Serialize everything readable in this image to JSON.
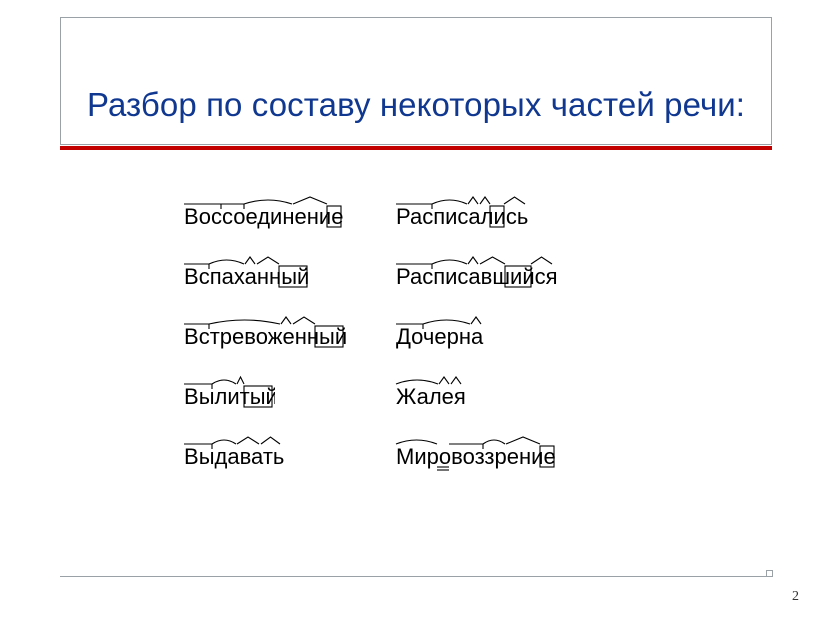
{
  "title": "Разбор по составу некоторых частей речи:",
  "page_number": "2",
  "columns": [
    {
      "words": [
        {
          "text": "Воссоединение",
          "chars": [
            {
              "c": "В",
              "w": 14,
              "mk": "prefix",
              "seg": "a"
            },
            {
              "c": "о",
              "w": 12,
              "mk": "prefix",
              "seg": "a"
            },
            {
              "c": "с",
              "w": 11,
              "mk": "prefix",
              "seg": "a"
            },
            {
              "c": "с",
              "w": 11,
              "mk": "prefix",
              "seg": "b"
            },
            {
              "c": "о",
              "w": 12,
              "mk": "prefix",
              "seg": "b"
            },
            {
              "c": "е",
              "w": 12,
              "mk": "root",
              "seg": "c"
            },
            {
              "c": "д",
              "w": 12,
              "mk": "root",
              "seg": "c"
            },
            {
              "c": "и",
              "w": 12,
              "mk": "root",
              "seg": "c"
            },
            {
              "c": "н",
              "w": 12,
              "mk": "root",
              "seg": "c"
            },
            {
              "c": "е",
              "w": 12,
              "mk": "suffix",
              "seg": "d"
            },
            {
              "c": "н",
              "w": 12,
              "mk": "suffix",
              "seg": "d"
            },
            {
              "c": "и",
              "w": 12,
              "mk": "suffix",
              "seg": "d"
            },
            {
              "c": "е",
              "w": 12,
              "mk": "ending",
              "seg": "e"
            }
          ]
        },
        {
          "text": "Вспаханный",
          "chars": [
            {
              "c": "В",
              "w": 14,
              "mk": "prefix",
              "seg": "a"
            },
            {
              "c": "с",
              "w": 11,
              "mk": "prefix",
              "seg": "a"
            },
            {
              "c": "п",
              "w": 12,
              "mk": "root",
              "seg": "b"
            },
            {
              "c": "а",
              "w": 12,
              "mk": "root",
              "seg": "b"
            },
            {
              "c": "х",
              "w": 11,
              "mk": "root",
              "seg": "b"
            },
            {
              "c": "а",
              "w": 12,
              "mk": "suffix",
              "seg": "c"
            },
            {
              "c": "н",
              "w": 12,
              "mk": "suffix",
              "seg": "d"
            },
            {
              "c": "н",
              "w": 12,
              "mk": "suffix",
              "seg": "d"
            },
            {
              "c": "ы",
              "w": 14,
              "mk": "ending",
              "seg": "e"
            },
            {
              "c": "й",
              "w": 12,
              "mk": "ending",
              "seg": "e"
            }
          ]
        },
        {
          "text": "Встревоженный",
          "chars": [
            {
              "c": "В",
              "w": 14,
              "mk": "prefix",
              "seg": "a"
            },
            {
              "c": "с",
              "w": 11,
              "mk": "prefix",
              "seg": "a"
            },
            {
              "c": "т",
              "w": 9,
              "mk": "root",
              "seg": "b"
            },
            {
              "c": "р",
              "w": 12,
              "mk": "root",
              "seg": "b"
            },
            {
              "c": "е",
              "w": 12,
              "mk": "root",
              "seg": "b"
            },
            {
              "c": "в",
              "w": 12,
              "mk": "root",
              "seg": "b"
            },
            {
              "c": "о",
              "w": 12,
              "mk": "root",
              "seg": "b"
            },
            {
              "c": "ж",
              "w": 14,
              "mk": "root",
              "seg": "b"
            },
            {
              "c": "е",
              "w": 12,
              "mk": "suffix",
              "seg": "c"
            },
            {
              "c": "н",
              "w": 12,
              "mk": "suffix",
              "seg": "d"
            },
            {
              "c": "н",
              "w": 12,
              "mk": "suffix",
              "seg": "d"
            },
            {
              "c": "ы",
              "w": 14,
              "mk": "ending",
              "seg": "e"
            },
            {
              "c": "й",
              "w": 12,
              "mk": "ending",
              "seg": "e"
            }
          ]
        },
        {
          "text": "Вылитый",
          "chars": [
            {
              "c": "В",
              "w": 14,
              "mk": "prefix",
              "seg": "a"
            },
            {
              "c": "ы",
              "w": 14,
              "mk": "prefix",
              "seg": "a"
            },
            {
              "c": "л",
              "w": 12,
              "mk": "root",
              "seg": "b"
            },
            {
              "c": "и",
              "w": 12,
              "mk": "root",
              "seg": "b"
            },
            {
              "c": "т",
              "w": 9,
              "mk": "suffix",
              "seg": "c"
            },
            {
              "c": "ы",
              "w": 14,
              "mk": "ending",
              "seg": "d"
            },
            {
              "c": "й",
              "w": 12,
              "mk": "ending",
              "seg": "d"
            }
          ]
        },
        {
          "text": "Выдавать",
          "chars": [
            {
              "c": "В",
              "w": 14,
              "mk": "prefix",
              "seg": "a"
            },
            {
              "c": "ы",
              "w": 14,
              "mk": "prefix",
              "seg": "a"
            },
            {
              "c": "д",
              "w": 12,
              "mk": "root",
              "seg": "b"
            },
            {
              "c": "а",
              "w": 12,
              "mk": "root",
              "seg": "b"
            },
            {
              "c": "в",
              "w": 12,
              "mk": "suffix",
              "seg": "c"
            },
            {
              "c": "а",
              "w": 12,
              "mk": "suffix",
              "seg": "c"
            },
            {
              "c": "т",
              "w": 9,
              "mk": "suffix",
              "seg": "d"
            },
            {
              "c": "ь",
              "w": 12,
              "mk": "suffix",
              "seg": "d"
            }
          ]
        }
      ]
    },
    {
      "words": [
        {
          "text": "Расписались",
          "chars": [
            {
              "c": "Р",
              "w": 13,
              "mk": "prefix",
              "seg": "a"
            },
            {
              "c": "а",
              "w": 12,
              "mk": "prefix",
              "seg": "a"
            },
            {
              "c": "с",
              "w": 11,
              "mk": "prefix",
              "seg": "a"
            },
            {
              "c": "п",
              "w": 12,
              "mk": "root",
              "seg": "b"
            },
            {
              "c": "и",
              "w": 12,
              "mk": "root",
              "seg": "b"
            },
            {
              "c": "с",
              "w": 11,
              "mk": "root",
              "seg": "b"
            },
            {
              "c": "а",
              "w": 12,
              "mk": "suffix",
              "seg": "c"
            },
            {
              "c": "л",
              "w": 12,
              "mk": "suffix",
              "seg": "d"
            },
            {
              "c": "и",
              "w": 12,
              "mk": "ending",
              "seg": "e"
            },
            {
              "c": "с",
              "w": 11,
              "mk": "suffix",
              "seg": "f"
            },
            {
              "c": "ь",
              "w": 12,
              "mk": "suffix",
              "seg": "f"
            }
          ]
        },
        {
          "text": "Расписавшийся",
          "chars": [
            {
              "c": "Р",
              "w": 13,
              "mk": "prefix",
              "seg": "a"
            },
            {
              "c": "а",
              "w": 12,
              "mk": "prefix",
              "seg": "a"
            },
            {
              "c": "с",
              "w": 11,
              "mk": "prefix",
              "seg": "a"
            },
            {
              "c": "п",
              "w": 12,
              "mk": "root",
              "seg": "b"
            },
            {
              "c": "и",
              "w": 12,
              "mk": "root",
              "seg": "b"
            },
            {
              "c": "с",
              "w": 11,
              "mk": "root",
              "seg": "b"
            },
            {
              "c": "а",
              "w": 12,
              "mk": "suffix",
              "seg": "c"
            },
            {
              "c": "в",
              "w": 12,
              "mk": "suffix",
              "seg": "d"
            },
            {
              "c": "ш",
              "w": 15,
              "mk": "suffix",
              "seg": "d"
            },
            {
              "c": "и",
              "w": 12,
              "mk": "ending",
              "seg": "e"
            },
            {
              "c": "й",
              "w": 12,
              "mk": "ending",
              "seg": "e"
            },
            {
              "c": "с",
              "w": 11,
              "mk": "suffix",
              "seg": "f"
            },
            {
              "c": "я",
              "w": 12,
              "mk": "suffix",
              "seg": "f"
            }
          ]
        },
        {
          "text": "Дочерна",
          "chars": [
            {
              "c": "Д",
              "w": 15,
              "mk": "prefix",
              "seg": "a"
            },
            {
              "c": "о",
              "w": 12,
              "mk": "prefix",
              "seg": "a"
            },
            {
              "c": "ч",
              "w": 11,
              "mk": "root",
              "seg": "b"
            },
            {
              "c": "е",
              "w": 12,
              "mk": "root",
              "seg": "b"
            },
            {
              "c": "р",
              "w": 12,
              "mk": "root",
              "seg": "b"
            },
            {
              "c": "н",
              "w": 12,
              "mk": "root",
              "seg": "b"
            },
            {
              "c": "а",
              "w": 12,
              "mk": "suffix",
              "seg": "c"
            }
          ]
        },
        {
          "text": "Жалея",
          "chars": [
            {
              "c": "Ж",
              "w": 18,
              "mk": "root",
              "seg": "a"
            },
            {
              "c": "а",
              "w": 12,
              "mk": "root",
              "seg": "a"
            },
            {
              "c": "л",
              "w": 12,
              "mk": "root",
              "seg": "a"
            },
            {
              "c": "е",
              "w": 12,
              "mk": "suffix",
              "seg": "b"
            },
            {
              "c": "я",
              "w": 12,
              "mk": "suffix",
              "seg": "c"
            }
          ]
        },
        {
          "text": "Мировоззрение",
          "chars": [
            {
              "c": "М",
              "w": 17,
              "mk": "root",
              "seg": "a"
            },
            {
              "c": "и",
              "w": 12,
              "mk": "root",
              "seg": "a"
            },
            {
              "c": "р",
              "w": 12,
              "mk": "root",
              "seg": "a"
            },
            {
              "c": "о",
              "w": 12,
              "mk": "linker",
              "seg": "b"
            },
            {
              "c": "в",
              "w": 12,
              "mk": "prefix",
              "seg": "c"
            },
            {
              "c": "о",
              "w": 12,
              "mk": "prefix",
              "seg": "c"
            },
            {
              "c": "з",
              "w": 10,
              "mk": "prefix",
              "seg": "c"
            },
            {
              "c": "з",
              "w": 10,
              "mk": "root",
              "seg": "d"
            },
            {
              "c": "р",
              "w": 12,
              "mk": "root",
              "seg": "d"
            },
            {
              "c": "е",
              "w": 12,
              "mk": "suffix",
              "seg": "e"
            },
            {
              "c": "н",
              "w": 12,
              "mk": "suffix",
              "seg": "e"
            },
            {
              "c": "и",
              "w": 12,
              "mk": "suffix",
              "seg": "e"
            },
            {
              "c": "е",
              "w": 12,
              "mk": "ending",
              "seg": "f"
            }
          ]
        }
      ]
    }
  ]
}
